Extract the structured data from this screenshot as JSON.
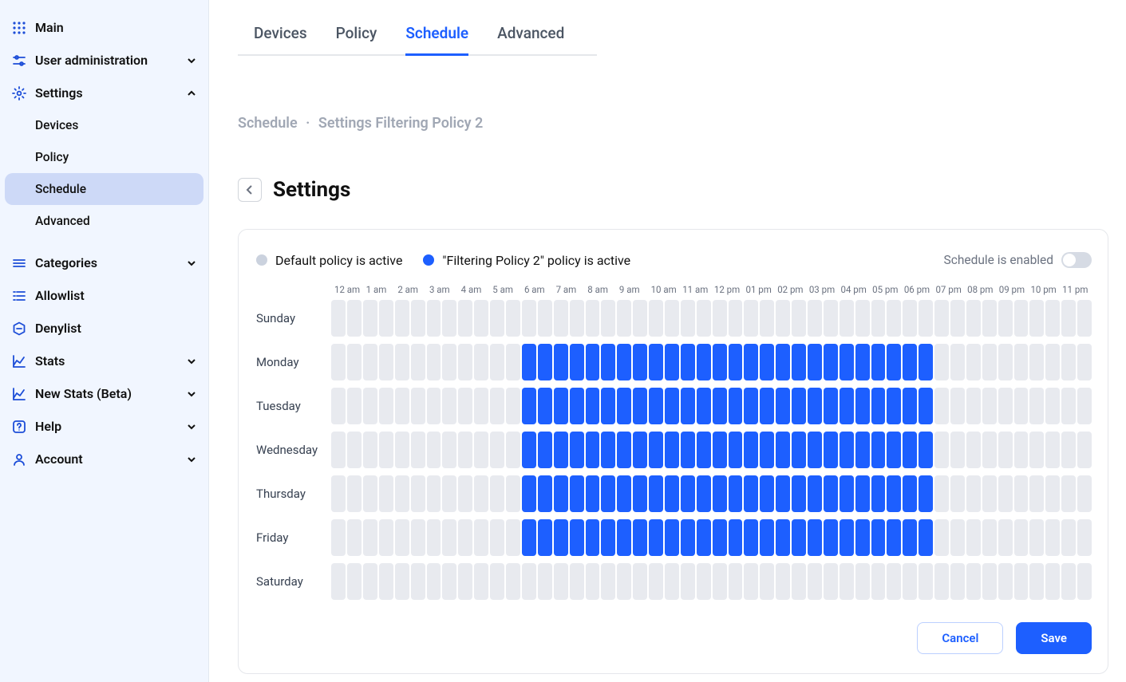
{
  "sidebar": {
    "items": [
      {
        "key": "main",
        "label": "Main",
        "icon": "grid-dots",
        "chev": null,
        "sub": []
      },
      {
        "key": "user-admin",
        "label": "User administration",
        "icon": "sliders",
        "chev": "down",
        "sub": []
      },
      {
        "key": "settings",
        "label": "Settings",
        "icon": "gear",
        "chev": "up",
        "sub": [
          {
            "key": "devices",
            "label": "Devices",
            "active": false
          },
          {
            "key": "policy",
            "label": "Policy",
            "active": false
          },
          {
            "key": "schedule",
            "label": "Schedule",
            "active": true
          },
          {
            "key": "advanced",
            "label": "Advanced",
            "active": false
          }
        ]
      },
      {
        "key": "categories",
        "label": "Categories",
        "icon": "lines",
        "chev": "down",
        "sub": []
      },
      {
        "key": "allowlist",
        "label": "Allowlist",
        "icon": "list-check",
        "chev": null,
        "sub": []
      },
      {
        "key": "denylist",
        "label": "Denylist",
        "icon": "hexagon-minus",
        "chev": null,
        "sub": []
      },
      {
        "key": "stats",
        "label": "Stats",
        "icon": "chart",
        "chev": "down",
        "sub": []
      },
      {
        "key": "newstats",
        "label": "New Stats (Beta)",
        "icon": "chart",
        "chev": "down",
        "sub": []
      },
      {
        "key": "help",
        "label": "Help",
        "icon": "help-square",
        "chev": "down",
        "sub": []
      },
      {
        "key": "account",
        "label": "Account",
        "icon": "user",
        "chev": "down",
        "sub": []
      }
    ]
  },
  "tabs": [
    {
      "key": "devices",
      "label": "Devices",
      "active": false
    },
    {
      "key": "policy",
      "label": "Policy",
      "active": false
    },
    {
      "key": "schedule",
      "label": "Schedule",
      "active": true
    },
    {
      "key": "advanced",
      "label": "Advanced",
      "active": false
    }
  ],
  "breadcrumb": {
    "first": "Schedule",
    "sep": "·",
    "second": "Settings Filtering Policy 2"
  },
  "page_title": "Settings",
  "legend": {
    "default_label": "Default policy is active",
    "policy_label": "\"Filtering Policy 2\" policy is active",
    "toggle_label": "Schedule is enabled",
    "toggle_on": false
  },
  "hours": [
    "12 am",
    "1 am",
    "2 am",
    "3 am",
    "4 am",
    "5 am",
    "6 am",
    "7 am",
    "8 am",
    "9 am",
    "10 am",
    "11 am",
    "12 pm",
    "01 pm",
    "02 pm",
    "03 pm",
    "04 pm",
    "05 pm",
    "06 pm",
    "07 pm",
    "08 pm",
    "09 pm",
    "10 pm",
    "11 pm"
  ],
  "days": [
    {
      "name": "Sunday",
      "on": false
    },
    {
      "name": "Monday",
      "on": true
    },
    {
      "name": "Tuesday",
      "on": true
    },
    {
      "name": "Wednesday",
      "on": true
    },
    {
      "name": "Thursday",
      "on": true
    },
    {
      "name": "Friday",
      "on": true
    },
    {
      "name": "Saturday",
      "on": false
    }
  ],
  "active_start_half": 12,
  "active_end_half": 38,
  "slots_per_day": 48,
  "buttons": {
    "cancel": "Cancel",
    "save": "Save"
  },
  "colors": {
    "accent": "#1d5fff",
    "slot_off": "#e8eaef"
  }
}
